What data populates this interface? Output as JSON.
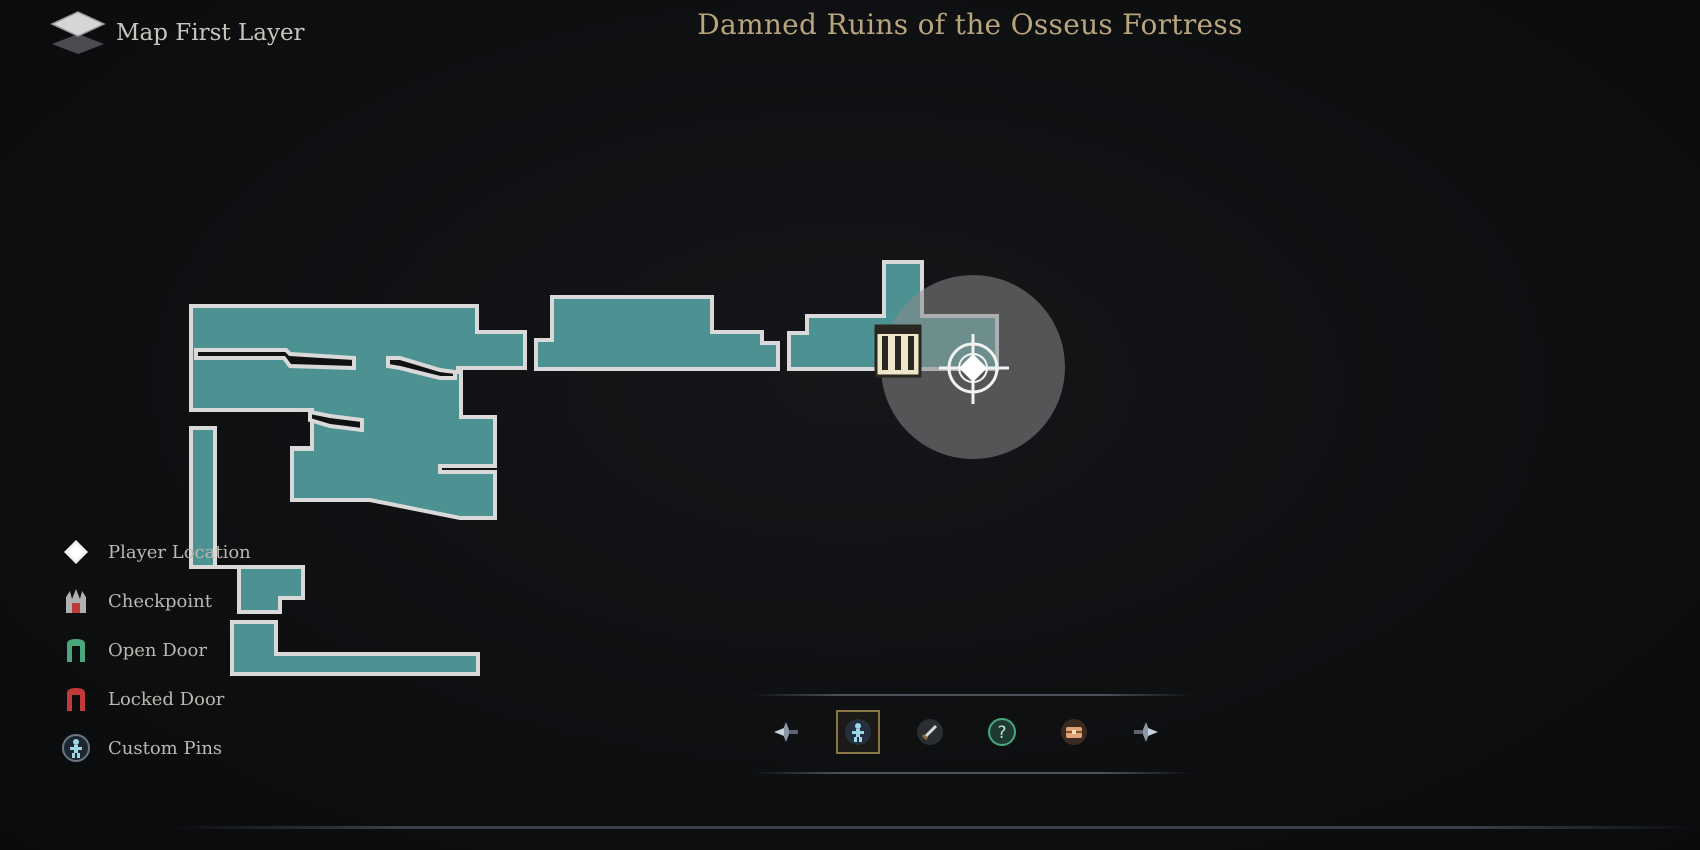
{
  "header": {
    "layer_label": "Map First Layer",
    "layer_icon": "layers-icon"
  },
  "map": {
    "title": "Damned Ruins of the Osseus Fortress",
    "room_color": "#4d9292",
    "wall_color": "#d9d9d9"
  },
  "legend": {
    "items": [
      {
        "label": "Player Location",
        "icon": "player-location-icon"
      },
      {
        "label": "Checkpoint",
        "icon": "checkpoint-icon"
      },
      {
        "label": "Open Door",
        "icon": "open-door-icon",
        "color": "#4aa77c"
      },
      {
        "label": "Locked Door",
        "icon": "locked-door-icon",
        "color": "#c03a3a"
      },
      {
        "label": "Custom Pins",
        "icon": "custom-pin-icon"
      }
    ]
  },
  "filters": {
    "buttons": [
      {
        "icon": "nav-left-icon"
      },
      {
        "icon": "custom-pin-filter-icon",
        "active": true
      },
      {
        "icon": "sword-icon"
      },
      {
        "icon": "question-icon"
      },
      {
        "icon": "chest-icon"
      },
      {
        "icon": "nav-right-icon"
      }
    ]
  }
}
